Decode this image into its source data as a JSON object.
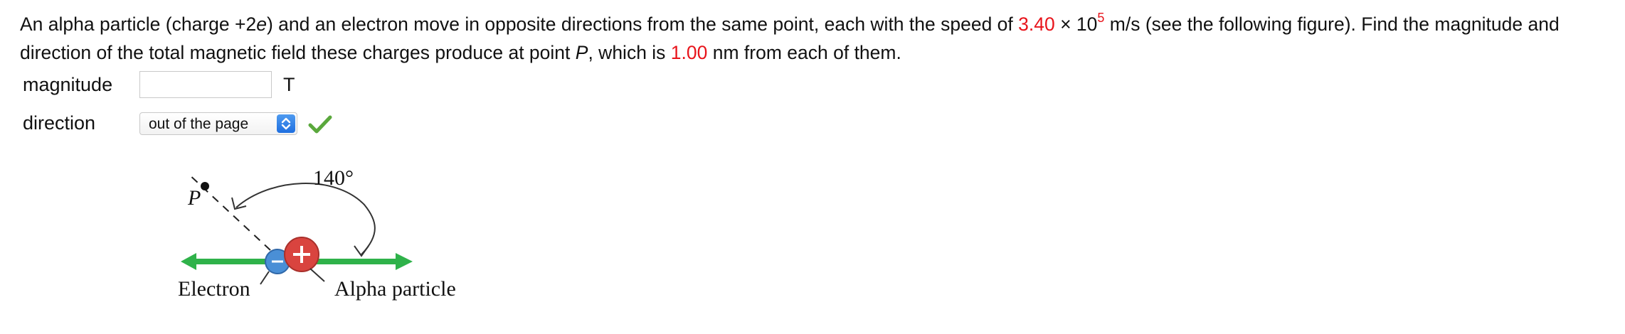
{
  "problem": {
    "part1": "An alpha particle (charge +2",
    "e_symbol": "e",
    "part2": ") and an electron move in opposite directions from the same point, each with the speed of ",
    "speed_mantissa": "3.40",
    "times_ten": " × 10",
    "speed_exponent": "5",
    "part3": " m/s (see the following figure). Find the magnitude and direction of the total magnetic field these charges produce at point ",
    "point_symbol": "P",
    "part4": ", which is ",
    "distance_value": "1.00",
    "part5": " nm from each of them."
  },
  "magnitude": {
    "label": "magnitude",
    "value": "",
    "unit": "T"
  },
  "direction": {
    "label": "direction",
    "selected": "out of the page",
    "status": "correct"
  },
  "figure": {
    "angle_label": "140°",
    "point_label": "P",
    "electron_label": "Electron",
    "alpha_label": "Alpha particle",
    "electron_sign": "−",
    "alpha_sign": "+"
  },
  "colors": {
    "highlight": "#e8141b",
    "arrow_green": "#2fb24a",
    "electron_blue": "#4a8fd6",
    "alpha_red": "#d9443f",
    "check_green": "#5aa83c"
  },
  "icons": {
    "select_arrow": "chevron-updown-icon",
    "status": "checkmark-icon"
  }
}
